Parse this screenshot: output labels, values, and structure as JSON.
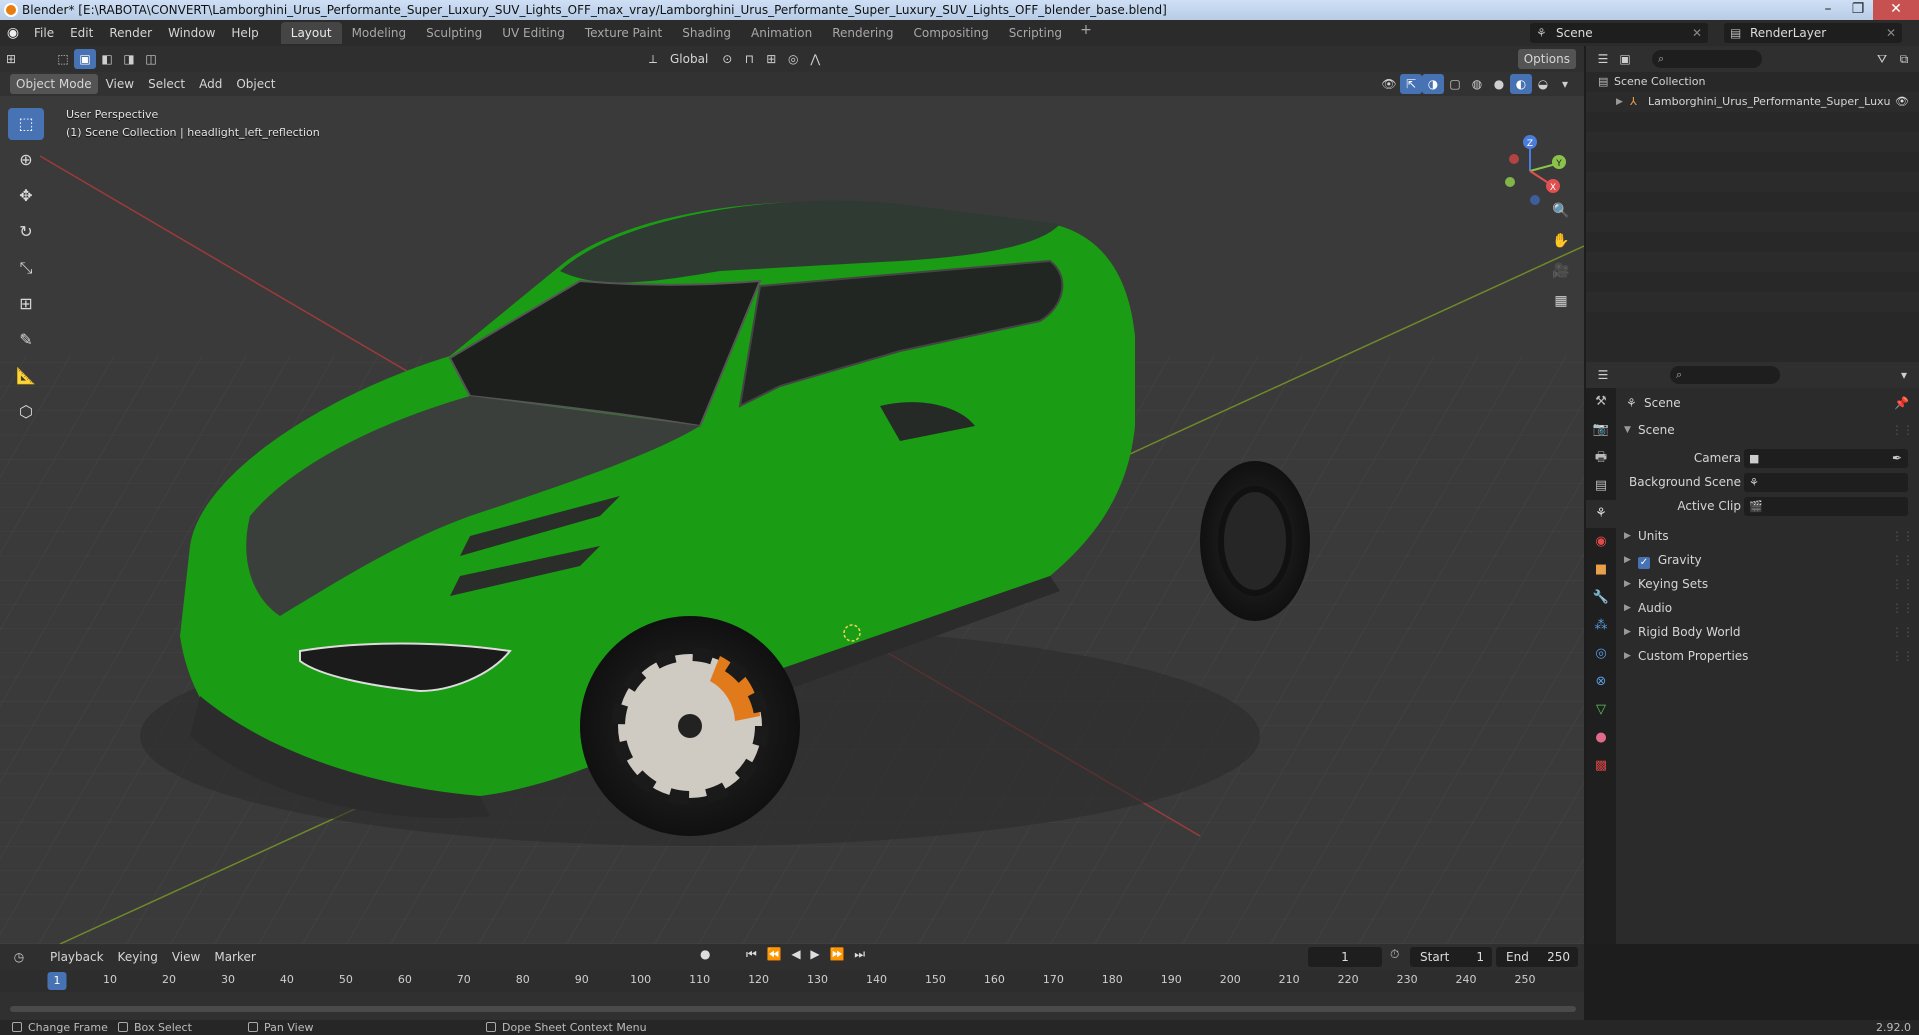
{
  "window": {
    "title": "Blender* [E:\\RABOTA\\CONVERT\\Lamborghini_Urus_Performante_Super_Luxury_SUV_Lights_OFF_max_vray/Lamborghini_Urus_Performante_Super_Luxury_SUV_Lights_OFF_blender_base.blend]"
  },
  "menu": [
    "File",
    "Edit",
    "Render",
    "Window",
    "Help"
  ],
  "workspaces": [
    "Layout",
    "Modeling",
    "Sculpting",
    "UV Editing",
    "Texture Paint",
    "Shading",
    "Animation",
    "Rendering",
    "Compositing",
    "Scripting"
  ],
  "workspace_active": "Layout",
  "scene_selector": "Scene",
  "view_layer": "RenderLayer",
  "viewport": {
    "transform_orientation": "Global",
    "options_label": "Options",
    "mode": "Object Mode",
    "header_menus": [
      "View",
      "Select",
      "Add",
      "Object"
    ],
    "perspective_label": "User Perspective",
    "collection_label": "(1) Scene Collection | headlight_left_reflection",
    "gizmo_axes": {
      "z": "Z",
      "y": "Y",
      "x": "X"
    },
    "car_color": "#1a9c14"
  },
  "outliner": {
    "root": "Scene Collection",
    "items": [
      "Lamborghini_Urus_Performante_Super_Luxu"
    ]
  },
  "properties": {
    "context_label": "Scene",
    "panel_title": "Scene",
    "fields": [
      {
        "label": "Camera",
        "value": ""
      },
      {
        "label": "Background Scene",
        "value": ""
      },
      {
        "label": "Active Clip",
        "value": ""
      }
    ],
    "subpanels": [
      "Units",
      "Gravity",
      "Keying Sets",
      "Audio",
      "Rigid Body World",
      "Custom Properties"
    ],
    "gravity_checked": true
  },
  "timeline": {
    "menus": [
      "Playback",
      "Keying",
      "View",
      "Marker"
    ],
    "current_frame": "1",
    "start_label": "Start",
    "start": "1",
    "end_label": "End",
    "end": "250",
    "ruler_ticks": [
      "1",
      "10",
      "20",
      "30",
      "40",
      "50",
      "60",
      "70",
      "80",
      "90",
      "100",
      "110",
      "120",
      "130",
      "140",
      "150",
      "160",
      "170",
      "180",
      "190",
      "200",
      "210",
      "220",
      "230",
      "240",
      "250"
    ]
  },
  "statusbar": {
    "items": [
      "Change Frame",
      "Box Select",
      "Pan View",
      "Dope Sheet Context Menu"
    ],
    "version": "2.92.0"
  },
  "colors": {
    "accent": "#4772b3",
    "car_green": "#1a9c14",
    "brake_orange": "#e07a1a"
  }
}
